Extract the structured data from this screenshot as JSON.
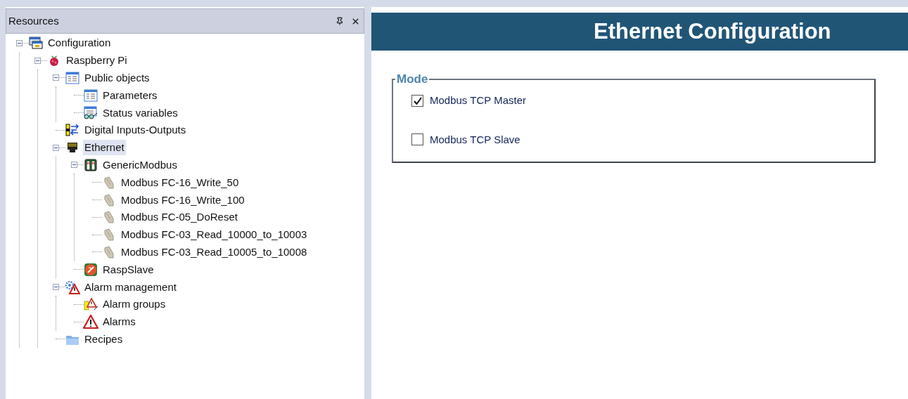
{
  "resources_panel": {
    "title": "Resources"
  },
  "tree": [
    {
      "label": "Configuration",
      "kind": "configuration",
      "expanded": true,
      "selected": false,
      "children": [
        {
          "label": "Raspberry Pi",
          "kind": "raspberry",
          "expanded": true,
          "selected": false,
          "children": [
            {
              "label": "Public objects",
              "kind": "list",
              "expanded": true,
              "selected": false,
              "children": [
                {
                  "label": "Parameters",
                  "kind": "list",
                  "selected": false
                },
                {
                  "label": "Status variables",
                  "kind": "status",
                  "selected": false
                }
              ]
            },
            {
              "label": "Digital Inputs-Outputs",
              "kind": "io",
              "selected": false
            },
            {
              "label": "Ethernet",
              "kind": "ethernet",
              "expanded": true,
              "selected": true,
              "children": [
                {
                  "label": "GenericModbus",
                  "kind": "device",
                  "expanded": true,
                  "selected": false,
                  "children": [
                    {
                      "label": "Modbus FC-16_Write_50",
                      "kind": "command",
                      "selected": false
                    },
                    {
                      "label": "Modbus FC-16_Write_100",
                      "kind": "command",
                      "selected": false
                    },
                    {
                      "label": "Modbus FC-05_DoReset",
                      "kind": "command",
                      "selected": false
                    },
                    {
                      "label": "Modbus FC-03_Read_10000_to_10003",
                      "kind": "command",
                      "selected": false
                    },
                    {
                      "label": "Modbus FC-03_Read_10005_to_10008",
                      "kind": "command",
                      "selected": false
                    }
                  ]
                },
                {
                  "label": "RaspSlave",
                  "kind": "slave",
                  "selected": false
                }
              ]
            },
            {
              "label": "Alarm management",
              "kind": "alarm_management",
              "expanded": true,
              "selected": false,
              "children": [
                {
                  "label": "Alarm groups",
                  "kind": "alarm_group",
                  "selected": false
                },
                {
                  "label": "Alarms",
                  "kind": "alarm",
                  "selected": false
                }
              ]
            },
            {
              "label": "Recipes",
              "kind": "folder",
              "selected": false
            }
          ]
        }
      ]
    }
  ],
  "editor": {
    "title": "Ethernet Configuration",
    "mode_group": {
      "legend": "Mode",
      "options": [
        {
          "label": "Modbus TCP Master",
          "checked": true
        },
        {
          "label": "Modbus TCP Slave",
          "checked": false
        }
      ]
    }
  }
}
